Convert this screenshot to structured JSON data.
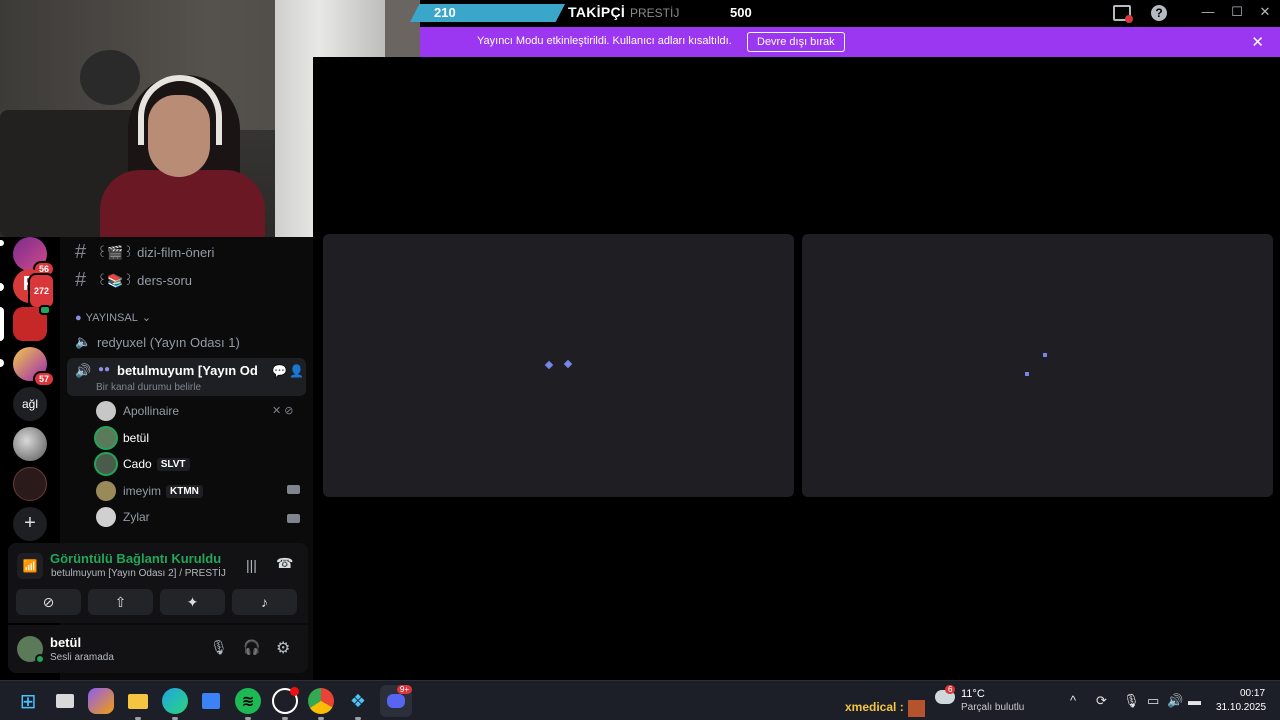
{
  "topbar": {
    "follower_count": "210",
    "follower_label": "TAKİPÇİ",
    "tier_label": "PRESTİJ",
    "goal_value": "500",
    "window_buttons": [
      "—",
      "☐",
      "✕"
    ]
  },
  "banner": {
    "text": "Yayıncı Modu etkinleştirildi. Kullanıcı adları kısaltıldı.",
    "button": "Devre dışı bırak"
  },
  "servers": [
    {
      "badge": "56"
    },
    {
      "badge": "272"
    },
    {
      "badge": ""
    },
    {
      "badge": "57"
    },
    {
      "label": "ağl"
    },
    {
      "badge": ""
    },
    {
      "badge": ""
    }
  ],
  "sidebar": {
    "channels": [
      {
        "name": "꒰🎬꒱ dizi-film-öneri"
      },
      {
        "name": "꒰📚꒱ ders-soru"
      }
    ],
    "category": "YAYINSAL",
    "voice_channel_1": "redyuxel (Yayın Odası 1)",
    "voice_channel_active": "betulmuyum [Yayın Od...",
    "channel_status_placeholder": "Bir kanal durumu belirle",
    "users": [
      {
        "name": "Apollinaire",
        "tag": ""
      },
      {
        "name": "betül",
        "tag": ""
      },
      {
        "name": "Cado",
        "tag": "SLVT"
      },
      {
        "name": "imeyim",
        "tag": "KTMN"
      },
      {
        "name": "Zylar",
        "tag": ""
      }
    ]
  },
  "voice_panel": {
    "status": "Görüntülü Bağlantı Kuruldu",
    "location": "betulmuyum [Yayın Odası 2] / PRESTİJ"
  },
  "user_panel": {
    "name": "betül",
    "status": "Sesli aramada"
  },
  "taskbar": {
    "streamer_text": "xmedical :",
    "weather_temp": "11°C",
    "weather_desc": "Parçalı bulutlu",
    "weather_badge": "6",
    "discord_badge": "9+",
    "time": "00:17",
    "date": "31.10.2025"
  },
  "colors": {
    "accent_purple": "#9b36f1",
    "follower_bar": "#3aa6c9",
    "connected_green": "#23a55a",
    "tile_bg": "#1f1f23"
  }
}
